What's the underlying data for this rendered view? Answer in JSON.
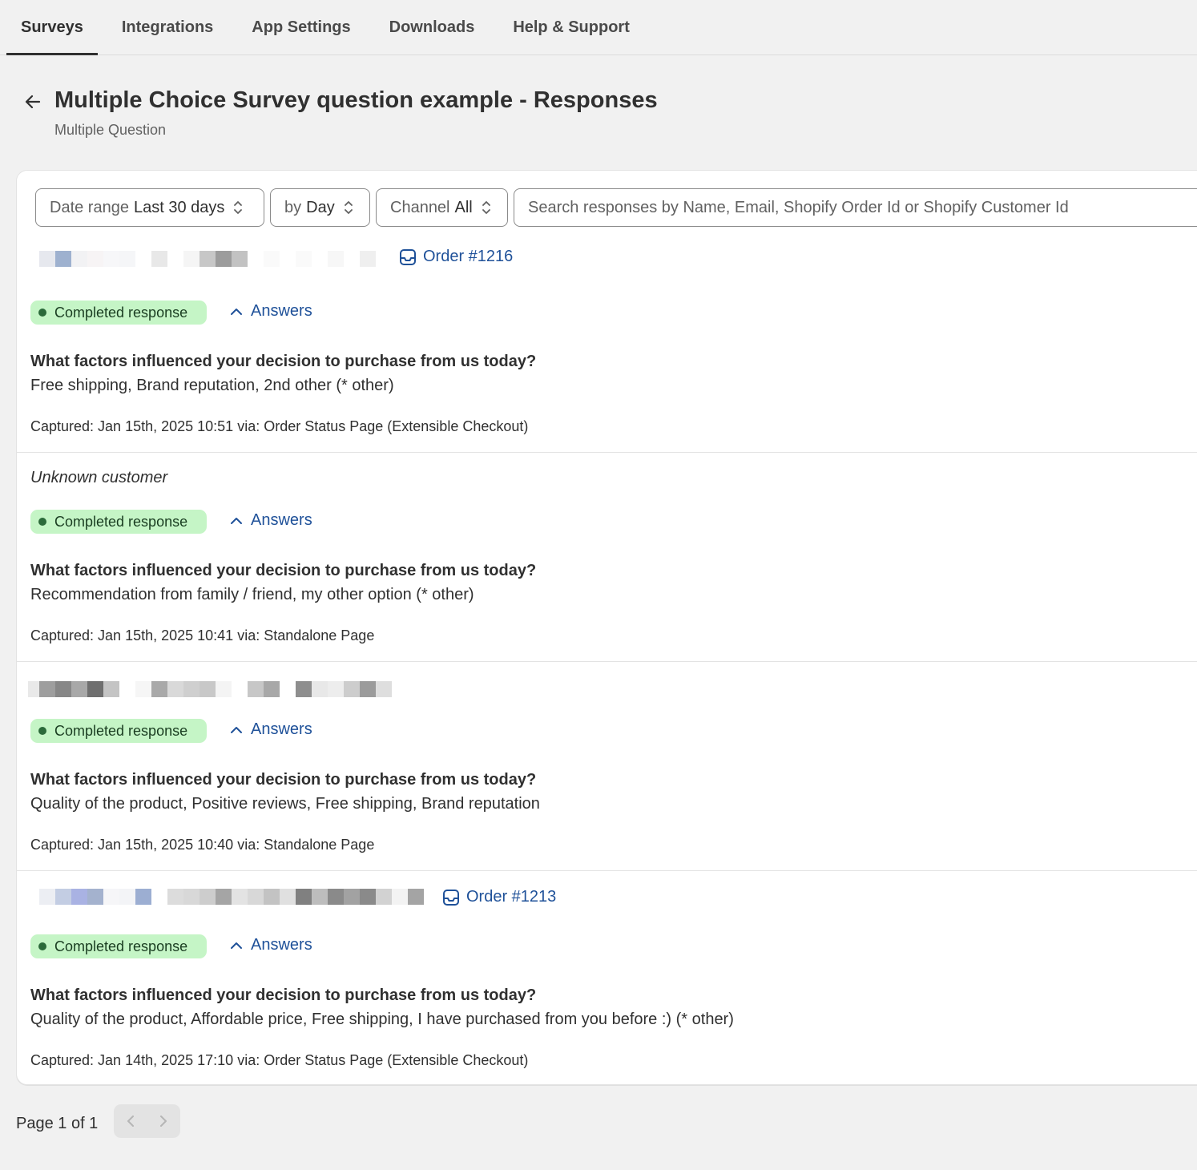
{
  "nav": {
    "tabs": [
      {
        "label": "Surveys",
        "active": true
      },
      {
        "label": "Integrations"
      },
      {
        "label": "App Settings"
      },
      {
        "label": "Downloads"
      },
      {
        "label": "Help & Support"
      }
    ]
  },
  "header": {
    "title": "Multiple Choice Survey question example - Responses",
    "subtitle": "Multiple Question",
    "back_icon": "arrow-left-icon"
  },
  "filters": {
    "date_range": {
      "label": "Date range",
      "value": "Last 30 days"
    },
    "granularity": {
      "label": "by",
      "value": "Day"
    },
    "channel": {
      "label": "Channel",
      "value": "All"
    },
    "search_placeholder": "Search responses by Name, Email, Shopify Order Id or Shopify Customer Id"
  },
  "responses": [
    {
      "customer": "",
      "order": "Order #1216",
      "status": "Completed response",
      "answers_toggle": "Answers",
      "question": "What factors influenced your decision to purchase from us today?",
      "answer": "Free shipping, Brand reputation, 2nd other (* other)",
      "captured": "Captured: Jan 15th, 2025 10:51 via: Order Status Page (Extensible Checkout)"
    },
    {
      "customer": "Unknown customer",
      "order": "",
      "status": "Completed response",
      "answers_toggle": "Answers",
      "question": "What factors influenced your decision to purchase from us today?",
      "answer": "Recommendation from family / friend, my other option (* other)",
      "captured": "Captured: Jan 15th, 2025 10:41 via: Standalone Page"
    },
    {
      "customer": "",
      "order": "",
      "status": "Completed response",
      "answers_toggle": "Answers",
      "question": "What factors influenced your decision to purchase from us today?",
      "answer": "Quality of the product, Positive reviews, Free shipping, Brand reputation",
      "captured": "Captured: Jan 15th, 2025 10:40 via: Standalone Page"
    },
    {
      "customer": "",
      "order": "Order #1213",
      "status": "Completed response",
      "answers_toggle": "Answers",
      "question": "What factors influenced your decision to purchase from us today?",
      "answer": "Quality of the product, Affordable price, Free shipping, I have purchased from you before :) (* other)",
      "captured": "Captured: Jan 14th, 2025 17:10 via: Order Status Page (Extensible Checkout)"
    }
  ],
  "pagination": {
    "label": "Page 1 of 1",
    "prev_icon": "chevron-left-icon",
    "next_icon": "chevron-right-icon"
  },
  "colors": {
    "link": "#1f5199",
    "badge_bg": "#c5f5c6",
    "badge_dot": "#2b6a3a",
    "page_bg": "#f1f1f1"
  }
}
